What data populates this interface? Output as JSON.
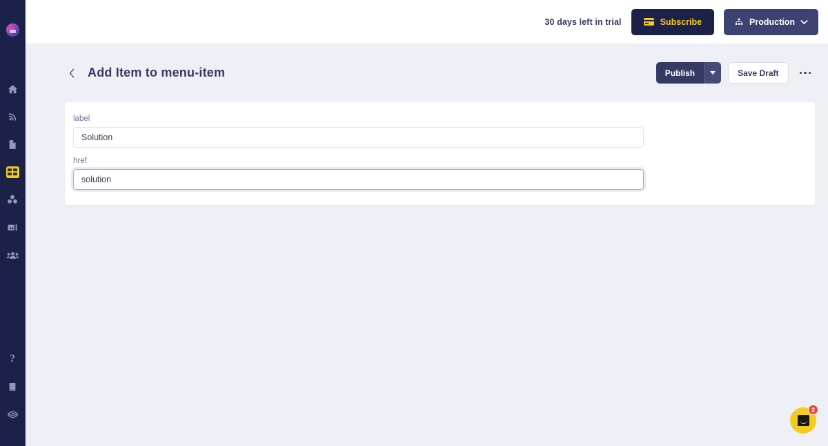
{
  "sidebar": {
    "logo": {
      "name": "workspace-logo"
    },
    "top_items": [
      {
        "icon": "home-icon",
        "label": "Home",
        "active": false
      },
      {
        "icon": "broadcast-icon",
        "label": "Blog",
        "active": false
      },
      {
        "icon": "document-icon",
        "label": "Pages",
        "active": false
      },
      {
        "icon": "collections-grid-icon",
        "label": "Collections",
        "active": true
      },
      {
        "icon": "components-icon",
        "label": "Components",
        "active": false
      },
      {
        "icon": "media-icon",
        "label": "Media",
        "active": false
      },
      {
        "icon": "team-icon",
        "label": "Team",
        "active": false
      }
    ],
    "bottom_items": [
      {
        "icon": "help-question-icon",
        "label": "Help",
        "active": false
      },
      {
        "icon": "book-icon",
        "label": "Docs",
        "active": false
      },
      {
        "icon": "layers-icon",
        "label": "Layers",
        "active": false
      }
    ]
  },
  "topbar": {
    "trial_text": "30 days left in trial",
    "subscribe_label": "Subscribe",
    "subscribe_icon": "credit-card-icon",
    "environment_label": "Production",
    "environment_icon": "sitemap-icon",
    "environment_chevron": "chevron-down-icon"
  },
  "header": {
    "back_icon": "chevron-left-icon",
    "title": "Add Item to menu-item",
    "publish_label": "Publish",
    "publish_dropdown_icon": "caret-down-icon",
    "save_draft_label": "Save Draft",
    "more_icon": "ellipsis-icon"
  },
  "form": {
    "fields": [
      {
        "name": "label",
        "label": "label",
        "value": "Solution",
        "placeholder": "",
        "focused": false
      },
      {
        "name": "href",
        "label": "href",
        "value": "solution",
        "placeholder": "",
        "focused": true
      }
    ]
  },
  "intercom": {
    "icon": "chat-bubble-icon",
    "badge_count": "2"
  },
  "colors": {
    "sidebar_bg": "#1b2149",
    "accent_yellow": "#f5cc19",
    "navy": "#343a63",
    "page_bg": "#eff0f6",
    "badge_red": "#ec4a3c"
  }
}
